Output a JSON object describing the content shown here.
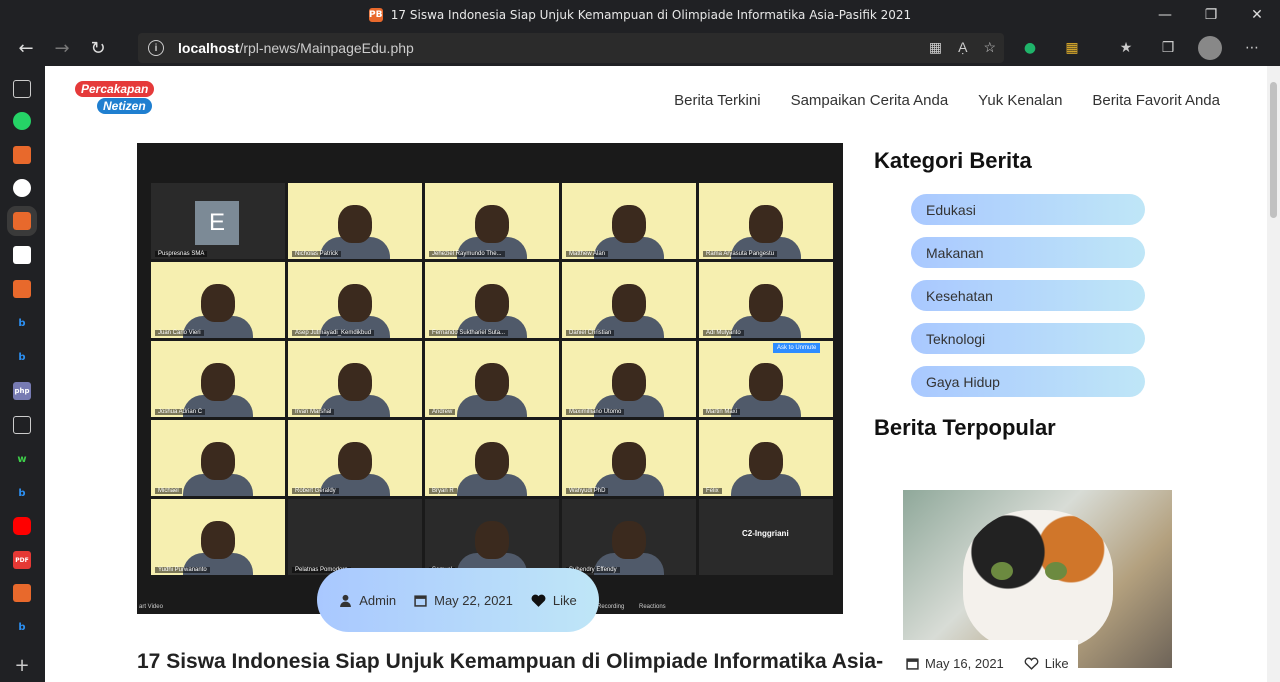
{
  "window": {
    "title": "17 Siswa Indonesia Siap Unjuk Kemampuan di Olimpiade Informatika Asia-Pasifik 2021",
    "tab_icon_label": "PB"
  },
  "address_bar": {
    "host": "localhost",
    "path": "/rpl-news/MainpageEdu.php"
  },
  "site": {
    "logo_line1": "Percakapan",
    "logo_line2": "Netizen",
    "nav": [
      "Berita Terkini",
      "Sampaikan Cerita Anda",
      "Yuk Kenalan",
      "Berita Favorit Anda"
    ]
  },
  "hero": {
    "participants": [
      "Puspresnas SMA",
      "Nicholas Patrick",
      "Jeheziel Raymundo The...",
      "Matthew Alan",
      "Rama Aryasuta Pangestu",
      "Juan Carlo Vieri",
      "Asep Jutmayadi_Kemdikbud",
      "Fernando Sukthariel Suta...",
      "Daniel Christian",
      "Adi Mulyanto",
      "Joshua Adrian C",
      "Irvan Marshal",
      "Andrew",
      "Maximilliano Utomo",
      "Martin Maxi",
      "Michael",
      "Robert Geraldy",
      "Bryan R",
      "Wahyudi PhD",
      "Felix",
      "Yudhi Purwananto",
      "Pelatnas Pomodoro",
      "Samuel",
      "Suhendry Effendy",
      "C2-Inggriani"
    ],
    "zoom_bar_left": "art Video",
    "zoom_bar_recording": "Recording",
    "zoom_bar_reactions": "Reactions",
    "ask_label": "Ask to Unmute"
  },
  "article": {
    "author": "Admin",
    "date": "May 22, 2021",
    "like_label": "Like",
    "title": "17 Siswa Indonesia Siap Unjuk Kemampuan di Olimpiade Informatika Asia-"
  },
  "sidebar": {
    "categories_heading": "Kategori Berita",
    "categories": [
      "Edukasi",
      "Makanan",
      "Kesehatan",
      "Teknologi",
      "Gaya Hidup"
    ],
    "popular_heading": "Berita Terpopular",
    "popular": {
      "date": "May 16, 2021",
      "like_label": "Like"
    }
  },
  "colors": {
    "accent_pill_start": "#a9c8ff",
    "accent_pill_end": "#bfe6f7",
    "browser_chrome": "#202124"
  }
}
